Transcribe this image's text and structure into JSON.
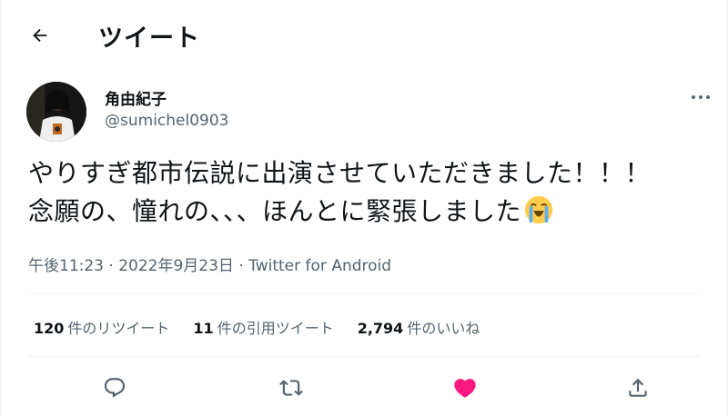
{
  "header": {
    "back_icon": "arrow-left-icon",
    "title": "ツイート"
  },
  "author": {
    "name": "角由紀子",
    "handle": "@sumichel0903",
    "more_icon": "more-horizontal-icon"
  },
  "tweet": {
    "lines": [
      "やりすぎ都市伝説に出演させていただきました！！！",
      "念願の、憧れの、、、ほんとに緊張しました"
    ],
    "emoji": "loudly-crying-face-emoji"
  },
  "meta": {
    "time": "午後11:23",
    "separator1": " · ",
    "date": "2022年9月23日",
    "separator2": " · ",
    "app": "Twitter for Android"
  },
  "stats": {
    "retweets": {
      "count": "120",
      "label": "件のリツイート"
    },
    "quotes": {
      "count": "11",
      "label": "件の引用ツイート"
    },
    "likes": {
      "count": "2,794",
      "label": "件のいいね"
    }
  },
  "actions": {
    "reply_icon": "reply-icon",
    "retweet_icon": "retweet-icon",
    "like_icon": "heart-icon",
    "share_icon": "share-icon"
  },
  "colors": {
    "text": "#0f1419",
    "secondary": "#536471",
    "like": "#f91880",
    "divider": "#eff3f4"
  }
}
